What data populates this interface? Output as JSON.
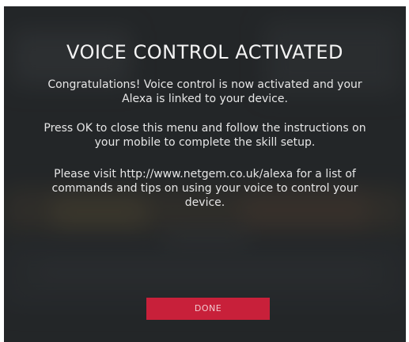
{
  "dialog": {
    "title": "VOICE CONTROL ACTIVATED",
    "paragraphs": [
      "Congratulations! Voice control is now activated and your Alexa is linked to your device.",
      "Press OK to close this menu and follow the instructions on your mobile to complete the skill setup.",
      "Please visit http://www.netgem.co.uk/alexa for a list of commands and tips on using your voice to control your device."
    ],
    "done_label": "DONE"
  },
  "colors": {
    "background": "#2b2d2f",
    "button": "#c8203a",
    "text": "#e6e6e6"
  }
}
